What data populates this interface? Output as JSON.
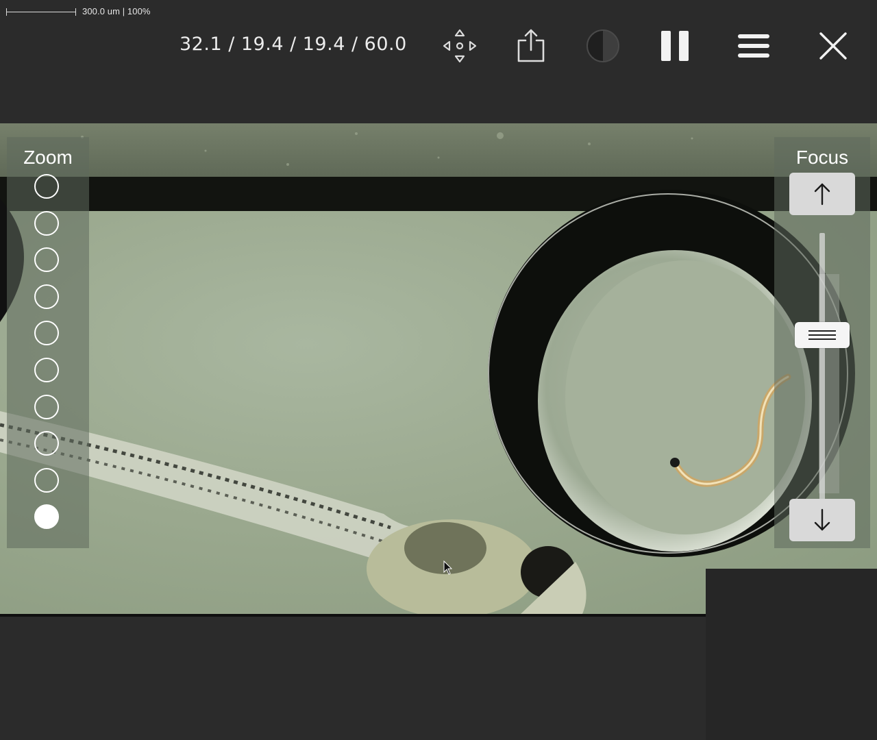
{
  "scale": {
    "text": "300.0 um | 100%"
  },
  "toolbar": {
    "readout": "32.1 / 19.4 / 19.4 / 60.0",
    "icons": [
      "move-icon",
      "share-icon",
      "contrast-icon",
      "pause-icon",
      "menu-icon",
      "close-icon"
    ]
  },
  "zoom": {
    "title": "Zoom",
    "levels": 10,
    "selected_index": 9
  },
  "focus": {
    "title": "Focus",
    "up_icon": "arrow-up-icon",
    "down_icon": "arrow-down-icon",
    "handle_icon": "slider-grip-icon"
  },
  "colors": {
    "background": "#2b2b2b",
    "panel": "#5f695c",
    "button": "#d9d9d9",
    "inactive_icon": "#555555"
  }
}
